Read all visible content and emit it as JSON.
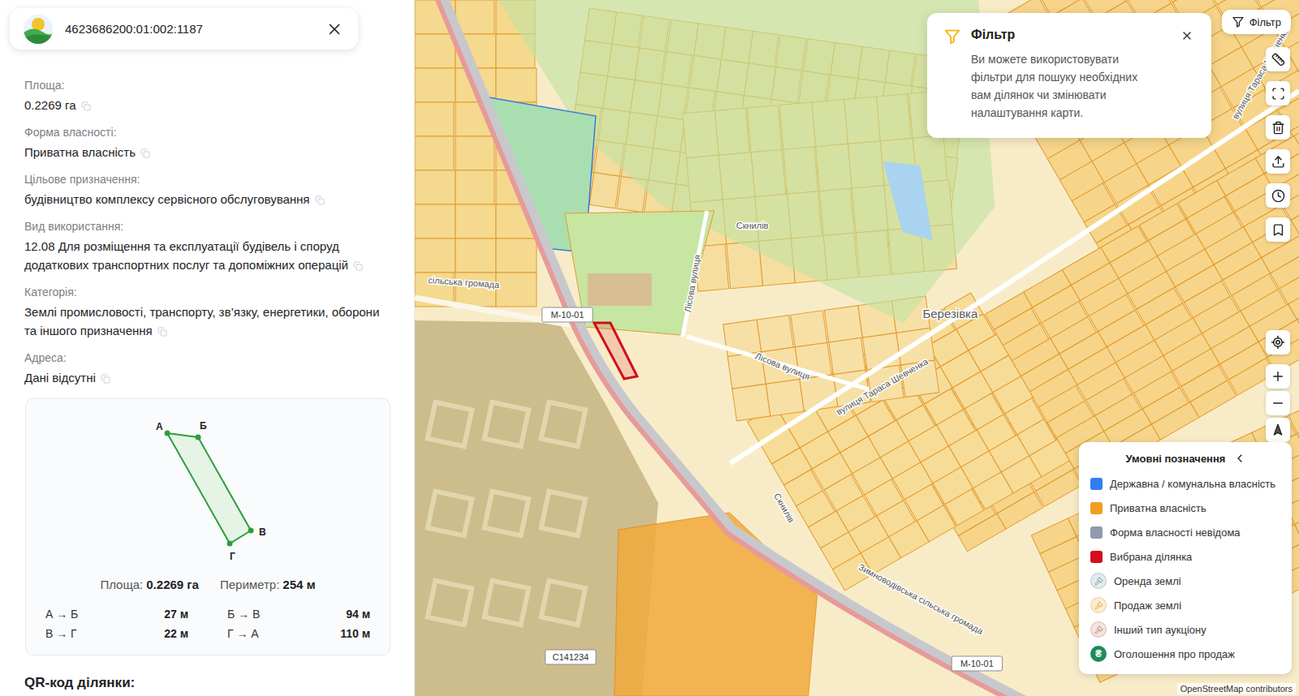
{
  "parcel": {
    "cadastral_number": "4623686200:01:002:1187"
  },
  "fields": [
    {
      "label": "Площа:",
      "value": "0.2269 га"
    },
    {
      "label": "Форма власності:",
      "value": "Приватна власність"
    },
    {
      "label": "Цільове призначення:",
      "value": "будівництво комплексу сервісного обслуговування"
    },
    {
      "label": "Вид використання:",
      "value": "12.08 Для розміщення та експлуатації будівель і споруд додаткових транспортних послуг та допоміжних операцій"
    },
    {
      "label": "Категорія:",
      "value": "Землі промисловості, транспорту, зв’язку, енергетики, оборони та іншого призначення"
    },
    {
      "label": "Адреса:",
      "value": "Дані відсутні"
    }
  ],
  "shape": {
    "vertices": [
      {
        "label": "А"
      },
      {
        "label": "Б"
      },
      {
        "label": "В"
      },
      {
        "label": "Г"
      }
    ],
    "area_label": "Площа:",
    "area": "0.2269 га",
    "perimeter_label": "Периметр:",
    "perimeter": "254 м",
    "sides": [
      {
        "label": "А → Б",
        "length": "27 м"
      },
      {
        "label": "Б → В",
        "length": "94 м"
      },
      {
        "label": "В → Г",
        "length": "22 м"
      },
      {
        "label": "Г → А",
        "length": "110 м"
      }
    ]
  },
  "qr_title": "QR-код ділянки:",
  "map": {
    "labels": [
      {
        "text": "М-10-01",
        "kind": "road-badge"
      },
      {
        "text": "М-10-01",
        "kind": "road-badge"
      },
      {
        "text": "С141234",
        "kind": "road-badge"
      },
      {
        "text": "Березівка",
        "kind": "place"
      },
      {
        "text": "Лісова вулиця",
        "kind": "street"
      },
      {
        "text": "Лісова вулиця",
        "kind": "street"
      },
      {
        "text": "Скнилів",
        "kind": "street"
      },
      {
        "text": "Скнилів",
        "kind": "street"
      },
      {
        "text": "вулиця Тараса Шевченка",
        "kind": "street"
      },
      {
        "text": "вулиця Тараса Шевченка",
        "kind": "street"
      },
      {
        "text": "Зимноводівська сільська громада",
        "kind": "region"
      },
      {
        "text": "сільська громада",
        "kind": "region"
      }
    ],
    "attribution": "OpenStreetMap contributors",
    "selected_parcel": true
  },
  "filter_button": {
    "label": "Фільтр"
  },
  "filter_popup": {
    "title": "Фільтр",
    "text": "Ви можете використовувати фільтри для пошуку необхідних вам ділянок чи змінювати налаштування карти."
  },
  "legend": {
    "title": "Умовні позначення",
    "items": [
      {
        "label": "Державна / комунальна власність",
        "kind": "swatch",
        "color": "#2f7ff0"
      },
      {
        "label": "Приватна власність",
        "kind": "swatch",
        "color": "#f0a020"
      },
      {
        "label": "Форма власності невідома",
        "kind": "swatch",
        "color": "#8f9aae"
      },
      {
        "label": "Вибрана ділянка",
        "kind": "swatch",
        "color": "#d40c1c"
      },
      {
        "label": "Оренда землі",
        "kind": "auction",
        "color": "#7a98a6"
      },
      {
        "label": "Продаж землі",
        "kind": "auction",
        "color": "#e8a52a"
      },
      {
        "label": "Інший тип аукціону",
        "kind": "auction",
        "color": "#c27a68"
      },
      {
        "label": "Оголошення про продаж",
        "kind": "announcement",
        "color": "#1f8a5b",
        "icon": "₴"
      }
    ]
  }
}
